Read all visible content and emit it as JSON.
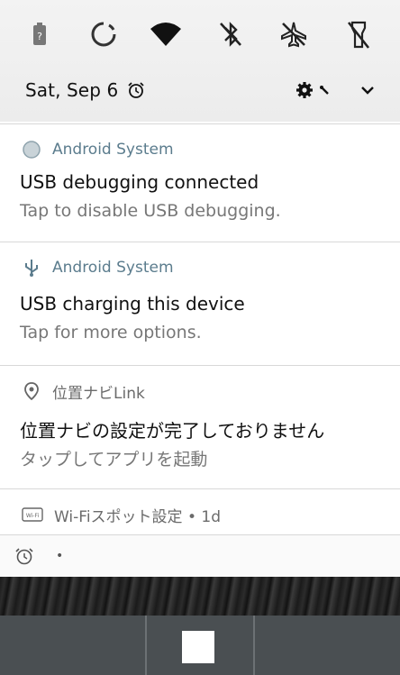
{
  "status_tiles": [
    {
      "icon": "battery-saver-icon"
    },
    {
      "icon": "auto-rotate-icon"
    },
    {
      "icon": "wifi-icon"
    },
    {
      "icon": "bluetooth-off-icon"
    },
    {
      "icon": "airplane-mode-off-icon"
    },
    {
      "icon": "flashlight-off-icon"
    }
  ],
  "header": {
    "date": "Sat, Sep 6"
  },
  "notifications": [
    {
      "app": "Android System",
      "title": "USB debugging connected",
      "text": "Tap to disable USB debugging."
    },
    {
      "app": "Android System",
      "title": "USB charging this device",
      "text": "Tap for more options."
    },
    {
      "app": "位置ナビLink",
      "title": "位置ナビの設定が完了しておりません",
      "text": "タップしてアプリを起動"
    },
    {
      "app": "Wi-Fiスポット設定 • 1d"
    }
  ],
  "alarm_bar": {
    "text": "•"
  },
  "colors": {
    "app_label": "#5b7c8d",
    "navbar": "#4a4f52"
  }
}
